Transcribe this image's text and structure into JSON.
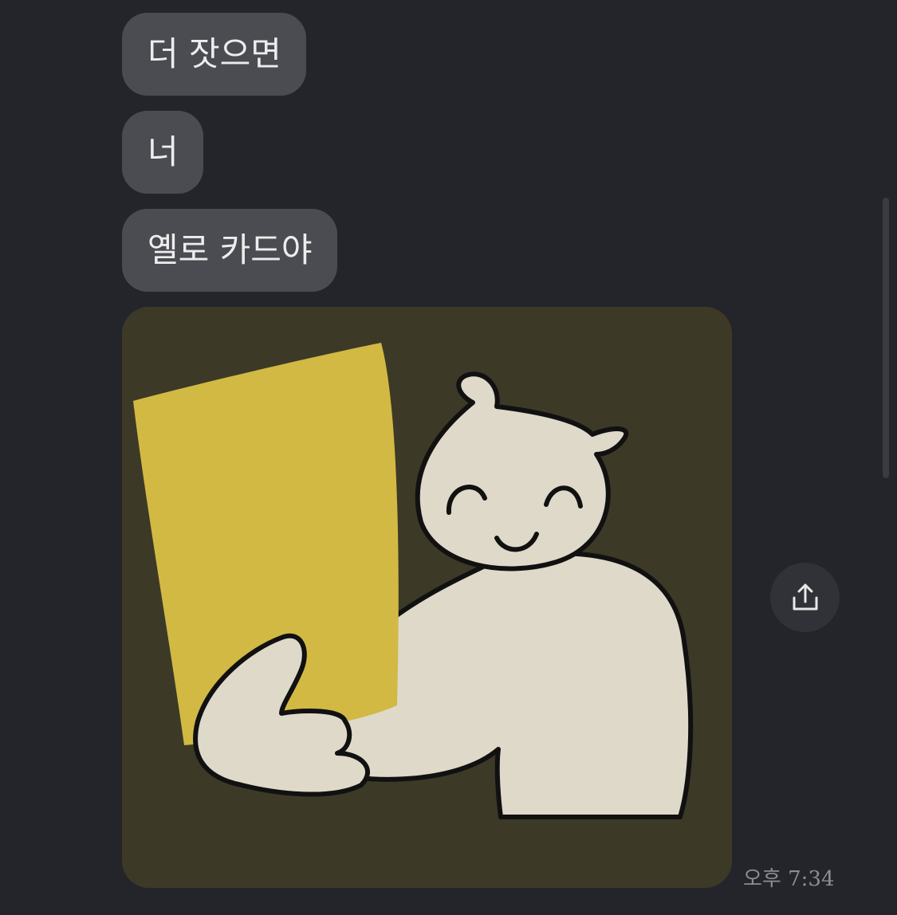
{
  "messages": [
    {
      "text": "더 잣으면"
    },
    {
      "text": "너"
    },
    {
      "text": "옐로 카드야"
    }
  ],
  "image_message": {
    "description_icon": "cat-holding-yellow-card-icon"
  },
  "share_button": {
    "icon": "share-upload-icon"
  },
  "timestamp": "오후 7:34",
  "colors": {
    "background": "#24252a",
    "bubble": "#4b4c52",
    "bubble_text": "#ededed",
    "photo_bg": "#3d3927",
    "card_yellow": "#d1b944",
    "cat_body": "#ded9c9"
  }
}
